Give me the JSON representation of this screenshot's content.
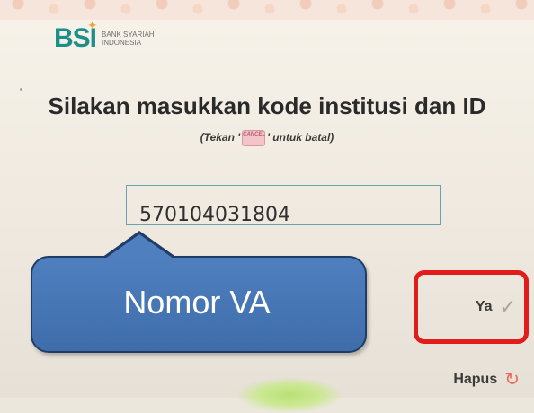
{
  "brand": {
    "logo_mark": "BSI",
    "bank_name_line1": "BANK SYARIAH",
    "bank_name_line2": "INDONESIA"
  },
  "prompt": {
    "title": "Silakan masukkan kode institusi dan ID",
    "hint_before": "(Tekan '",
    "cancel_chip": "CANCEL",
    "hint_after": "' untuk batal)"
  },
  "input": {
    "value": "570104031804"
  },
  "callout": {
    "text": "Nomor VA"
  },
  "actions": {
    "yes_label": "Ya",
    "clear_label": "Hapus"
  },
  "icons": {
    "yes": "check-icon",
    "clear": "refresh-icon"
  },
  "colors": {
    "brand_teal": "#1d8f8a",
    "highlight_red": "#e21b1b",
    "callout_blue": "#4f7fbf"
  }
}
